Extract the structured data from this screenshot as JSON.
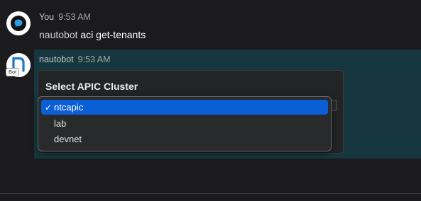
{
  "messages": [
    {
      "author": "You",
      "time": "9:53 AM",
      "prefix": "nautobot",
      "command": "aci get-tenants"
    },
    {
      "author": "nautobot",
      "time": "9:53 AM",
      "bot_badge": "Bot",
      "card": {
        "title": "Select APIC Cluster",
        "options": [
          {
            "label": "ntcapic",
            "selected": true
          },
          {
            "label": "lab",
            "selected": false
          },
          {
            "label": "devnet",
            "selected": false
          }
        ]
      }
    }
  ],
  "icons": {
    "you_avatar": "chat-bubble-icon",
    "bot_avatar": "nautobot-logo-icon",
    "check": "checkmark-icon"
  },
  "colors": {
    "accent": "#0b5fd6",
    "bot_message_bg": "#16373f",
    "background": "#1b1b1d"
  }
}
